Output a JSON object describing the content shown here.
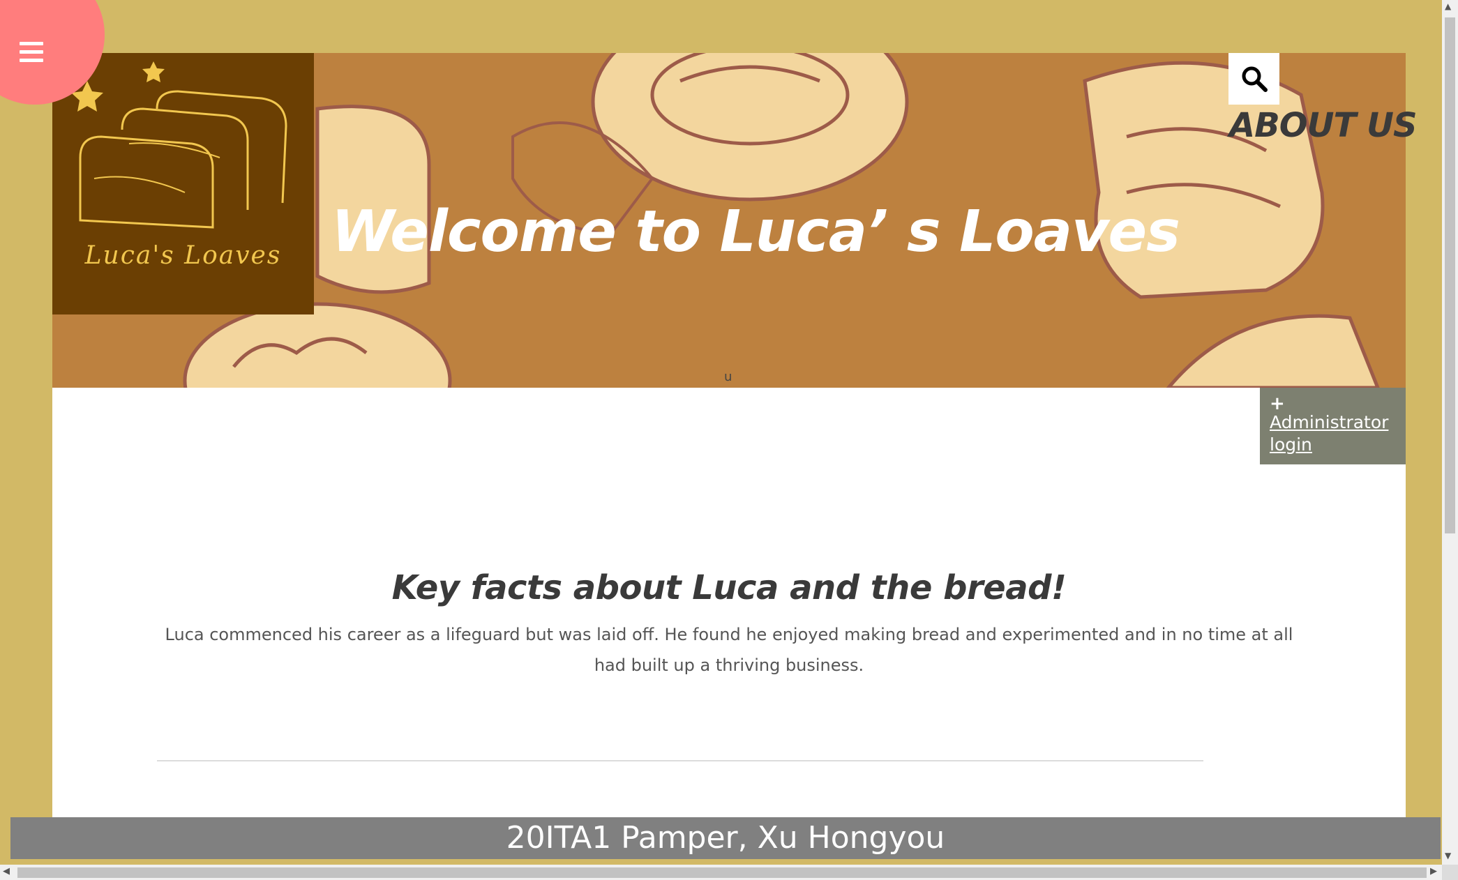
{
  "header": {
    "logo_text": "Luca's Loaves",
    "welcome": "Welcome to Luca’ s Loaves",
    "banner_marker": "u",
    "about_label": "ABOUT US"
  },
  "nav": {
    "menu_icon": "hamburger-menu-icon",
    "search_icon": "search-icon"
  },
  "admin": {
    "icon": "plus-icon",
    "plus": "+",
    "label": "Administrator login"
  },
  "main": {
    "title": "Key facts about Luca and the bread!",
    "body": "Luca commenced his career as a lifeguard but was laid off. He found he enjoyed making bread and experimented and in no time at all had built up a thriving business."
  },
  "footer": {
    "text": "20ITA1 Pamper, Xu Hongyou"
  },
  "colors": {
    "page_background": "#d2b966",
    "banner": "#bd813f",
    "logo_background": "#6b3f03",
    "menu_circle": "#ff7d7d",
    "admin_background": "#7d8070",
    "footer_background": "#808080"
  }
}
